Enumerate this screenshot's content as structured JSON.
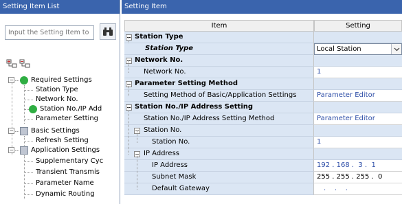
{
  "left_panel": {
    "title": "Setting Item List",
    "search_placeholder": "Input the Setting Item to",
    "tree": [
      {
        "label": "Required Settings"
      },
      {
        "label": "Station Type"
      },
      {
        "label": "Network No."
      },
      {
        "label": "Station No./IP Add"
      },
      {
        "label": "Parameter Setting"
      },
      {
        "label": "Basic Settings"
      },
      {
        "label": "Refresh Setting"
      },
      {
        "label": "Application Settings"
      },
      {
        "label": "Supplementary Cyc"
      },
      {
        "label": "Transient Transmis"
      },
      {
        "label": "Parameter Name"
      },
      {
        "label": "Dynamic Routing"
      }
    ]
  },
  "right_panel": {
    "title": "Setting Item",
    "columns": {
      "item": "Item",
      "setting": "Setting"
    },
    "rows": [
      {
        "item": "Station Type",
        "setting": ""
      },
      {
        "item": "Station Type",
        "setting": "Local Station"
      },
      {
        "item": "Network No.",
        "setting": ""
      },
      {
        "item": "Network No.",
        "setting": "1"
      },
      {
        "item": "Parameter Setting Method",
        "setting": ""
      },
      {
        "item": "Setting Method of Basic/Application Settings",
        "setting": "Parameter Editor"
      },
      {
        "item": "Station No./IP Address Setting",
        "setting": ""
      },
      {
        "item": "Station No./IP Address Setting Method",
        "setting": "Parameter Editor"
      },
      {
        "item": "Station No.",
        "setting": ""
      },
      {
        "item": "Station No.",
        "setting": "1"
      },
      {
        "item": "IP Address",
        "setting": ""
      },
      {
        "item": "IP Address",
        "setting": "192 . 168 .  3 .  1"
      },
      {
        "item": "Subnet Mask",
        "setting": "255 . 255 . 255 .  0"
      },
      {
        "item": "Default Gateway",
        "setting": ".    .    ."
      }
    ]
  }
}
